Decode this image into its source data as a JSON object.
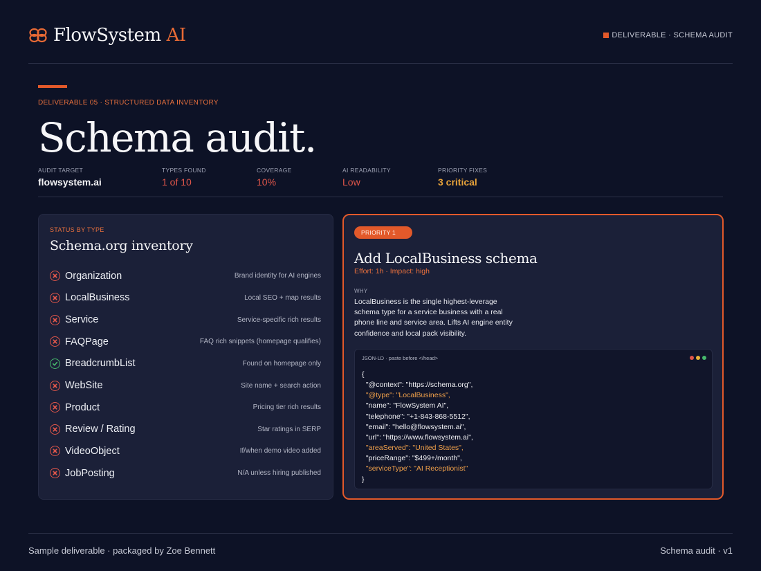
{
  "brand": {
    "name": "FlowSystem",
    "accent": "AI",
    "icon": "infinity-logo-icon",
    "color": "#e86a35"
  },
  "top_tag": "DELIVERABLE · SCHEMA AUDIT",
  "hero": {
    "eyebrow": "DELIVERABLE 05 · STRUCTURED DATA INVENTORY",
    "title": "Schema audit."
  },
  "stats": [
    {
      "label": "AUDIT TARGET",
      "value": "flowsystem.ai",
      "tone": "white"
    },
    {
      "label": "TYPES FOUND",
      "value": "1 of 10",
      "tone": "red"
    },
    {
      "label": "COVERAGE",
      "value": "10%",
      "tone": "red"
    },
    {
      "label": "AI READABILITY",
      "value": "Low",
      "tone": "red"
    },
    {
      "label": "PRIORITY FIXES",
      "value": "3 critical",
      "tone": "amber"
    }
  ],
  "inventory": {
    "eyebrow": "STATUS BY TYPE",
    "title": "Schema.org inventory",
    "items": [
      {
        "name": "Organization",
        "desc": "Brand identity for AI engines",
        "status": "missing"
      },
      {
        "name": "LocalBusiness",
        "desc": "Local SEO + map results",
        "status": "missing"
      },
      {
        "name": "Service",
        "desc": "Service-specific rich results",
        "status": "missing"
      },
      {
        "name": "FAQPage",
        "desc": "FAQ rich snippets (homepage qualifies)",
        "status": "missing"
      },
      {
        "name": "BreadcrumbList",
        "desc": "Found on homepage only",
        "status": "found"
      },
      {
        "name": "WebSite",
        "desc": "Site name + search action",
        "status": "missing"
      },
      {
        "name": "Product",
        "desc": "Pricing tier rich results",
        "status": "missing"
      },
      {
        "name": "Review / Rating",
        "desc": "Star ratings in SERP",
        "status": "missing"
      },
      {
        "name": "VideoObject",
        "desc": "If/when demo video added",
        "status": "missing"
      },
      {
        "name": "JobPosting",
        "desc": "N/A unless hiring published",
        "status": "missing"
      }
    ]
  },
  "priority": {
    "pill": "PRIORITY 1",
    "title": "Add LocalBusiness schema",
    "meta": "Effort: 1h · Impact: high",
    "why_label": "WHY",
    "why_text": "LocalBusiness is the single highest-leverage schema type for a service business with a real phone line and service area. Lifts AI engine entity confidence and local pack visibility.",
    "code_header": "JSON-LD · paste before </head>",
    "code_lines": [
      {
        "text": "{",
        "hl": false
      },
      {
        "text": "  \"@context\": \"https://schema.org\",",
        "hl": false
      },
      {
        "text": "  \"@type\": \"LocalBusiness\",",
        "hl": true
      },
      {
        "text": "  \"name\": \"FlowSystem AI\",",
        "hl": false
      },
      {
        "text": "  \"telephone\": \"+1-843-868-5512\",",
        "hl": false
      },
      {
        "text": "  \"email\": \"hello@flowsystem.ai\",",
        "hl": false
      },
      {
        "text": "  \"url\": \"https://www.flowsystem.ai\",",
        "hl": false
      },
      {
        "text": "  \"areaServed\": \"United States\",",
        "hl": true
      },
      {
        "text": "  \"priceRange\": \"$499+/month\",",
        "hl": false
      },
      {
        "text": "  \"serviceType\": \"AI Receptionist\"",
        "hl": true
      },
      {
        "text": "}",
        "hl": false
      }
    ],
    "window_dots": [
      "#e0564a",
      "#e8b43a",
      "#46b86c"
    ]
  },
  "footer": {
    "left": "Sample deliverable · packaged by Zoe Bennett",
    "right": "Schema audit · v1"
  }
}
